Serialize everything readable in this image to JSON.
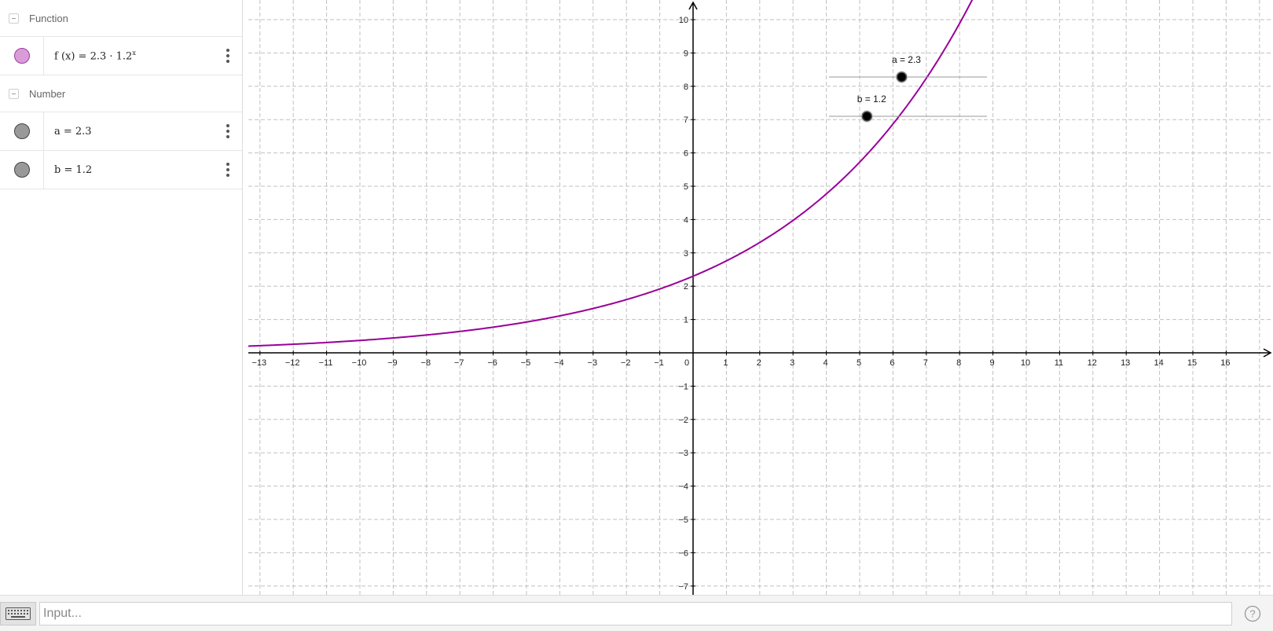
{
  "algebra": {
    "groups": [
      {
        "title": "Function",
        "items": [
          {
            "text": "f (x)  =  2.3 · 1.2",
            "sup": "x",
            "color": "#d99cd9"
          }
        ]
      },
      {
        "title": "Number",
        "items": [
          {
            "text": "a  =  2.3",
            "color": "#999999"
          },
          {
            "text": "b  =  1.2",
            "color": "#999999"
          }
        ]
      }
    ]
  },
  "graph": {
    "x_ticks": [
      "-13",
      "-12",
      "-11",
      "-10",
      "-9",
      "-8",
      "-7",
      "-6",
      "-5",
      "-4",
      "-3",
      "-2",
      "-1",
      "0",
      "1",
      "2",
      "3",
      "4",
      "5",
      "6",
      "7",
      "8",
      "9",
      "10",
      "11",
      "12",
      "13",
      "14",
      "15",
      "16"
    ],
    "y_ticks": [
      "10",
      "9",
      "8",
      "7",
      "6",
      "5",
      "4",
      "3",
      "2",
      "1",
      "-1",
      "-2",
      "-3",
      "-4",
      "-5",
      "-6",
      "-7"
    ],
    "function": {
      "a": 2.3,
      "b": 1.2,
      "color": "#990099"
    },
    "sliders": [
      {
        "label": "a = 2.3",
        "value": 2.3
      },
      {
        "label": "b = 1.2",
        "value": 1.2
      }
    ]
  },
  "input": {
    "placeholder": "Input..."
  },
  "colors": {
    "grid": "#c0c0c0",
    "axes": "#000000",
    "curve": "#990099"
  }
}
